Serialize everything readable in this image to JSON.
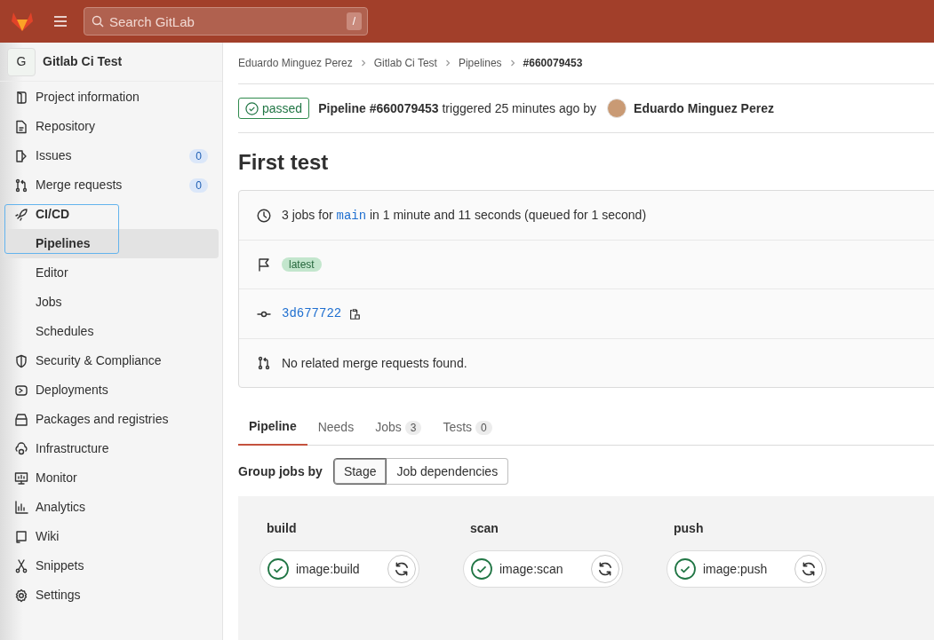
{
  "header": {
    "search_placeholder": "Search GitLab",
    "shortcut": "/"
  },
  "sidebar": {
    "project_initial": "G",
    "project_name": "Gitlab Ci Test",
    "items": [
      {
        "label": "Project information",
        "selected": false
      },
      {
        "label": "Repository",
        "selected": false
      },
      {
        "label": "Issues",
        "count": "0",
        "selected": false
      },
      {
        "label": "Merge requests",
        "count": "0",
        "selected": false
      },
      {
        "label": "CI/CD",
        "selected": false,
        "children": [
          {
            "label": "Pipelines",
            "selected": true
          },
          {
            "label": "Editor",
            "selected": false
          },
          {
            "label": "Jobs",
            "selected": false
          },
          {
            "label": "Schedules",
            "selected": false
          }
        ]
      },
      {
        "label": "Security & Compliance",
        "selected": false
      },
      {
        "label": "Deployments",
        "selected": false
      },
      {
        "label": "Packages and registries",
        "selected": false
      },
      {
        "label": "Infrastructure",
        "selected": false
      },
      {
        "label": "Monitor",
        "selected": false
      },
      {
        "label": "Analytics",
        "selected": false
      },
      {
        "label": "Wiki",
        "selected": false
      },
      {
        "label": "Snippets",
        "selected": false
      },
      {
        "label": "Settings",
        "selected": false
      }
    ]
  },
  "breadcrumbs": [
    {
      "label": "Eduardo Minguez Perez",
      "current": false
    },
    {
      "label": "Gitlab Ci Test",
      "current": false
    },
    {
      "label": "Pipelines",
      "current": false
    },
    {
      "label": "#660079453",
      "current": true
    }
  ],
  "pipeline": {
    "status": "passed",
    "summary": "**Pipeline #660079453** triggered 25 minutes ago by",
    "user": "Eduardo Minguez Perez",
    "title": "First test"
  },
  "info_rows": [
    {
      "kind": "duration",
      "prefix": "3 jobs for",
      "ref": "main",
      "suffix": "in 1 minute and 11 seconds (queued for 1 second)"
    },
    {
      "kind": "badge",
      "badge": "latest"
    },
    {
      "kind": "commit",
      "sha": "3d677722"
    },
    {
      "kind": "merge",
      "text": "No related merge requests found."
    }
  ],
  "tabs": [
    {
      "label": "Pipeline",
      "selected": true
    },
    {
      "label": "Needs",
      "selected": false
    },
    {
      "label": "Jobs",
      "count": "3",
      "selected": false
    },
    {
      "label": "Tests",
      "count": "0",
      "selected": false
    }
  ],
  "group_by": {
    "label": "Group jobs by",
    "options": [
      {
        "label": "Stage",
        "selected": true
      },
      {
        "label": "Job dependencies",
        "selected": false
      }
    ]
  },
  "stages": [
    {
      "name": "build",
      "jobs": [
        {
          "name": "image:build",
          "passed": true
        }
      ]
    },
    {
      "name": "scan",
      "jobs": [
        {
          "name": "image:scan",
          "passed": true
        }
      ]
    },
    {
      "name": "push",
      "jobs": [
        {
          "name": "image:push",
          "passed": true
        }
      ]
    }
  ],
  "annotation": {
    "highlight": true
  }
}
